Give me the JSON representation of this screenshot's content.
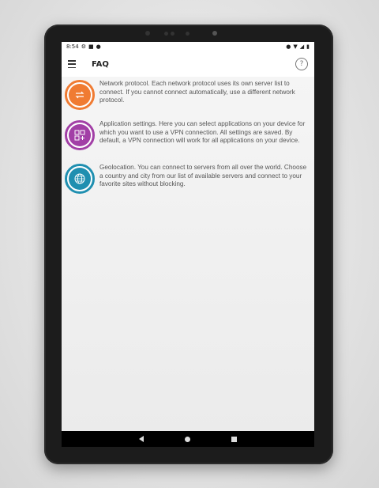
{
  "status_bar": {
    "time": "8:54"
  },
  "app_bar": {
    "title": "FAQ",
    "help_label": "?"
  },
  "faq_items": [
    {
      "icon": "protocol-switch-icon",
      "color": "#f07b32",
      "text": "Network protocol. Each network protocol uses its own server list to connect. If you cannot connect automatically, use a different network protocol."
    },
    {
      "icon": "app-grid-icon",
      "color": "#a23fa6",
      "text": "Application settings. Here you can select applications on your device for which you want to use a VPN connection. All settings are saved. By default, a VPN connection will work for all applications on your device."
    },
    {
      "icon": "globe-icon",
      "color": "#1f8fb0",
      "text": "Geolocation. You can connect to servers from all over the world. Choose a country and city from our list of available servers and connect to your favorite sites without blocking."
    }
  ]
}
